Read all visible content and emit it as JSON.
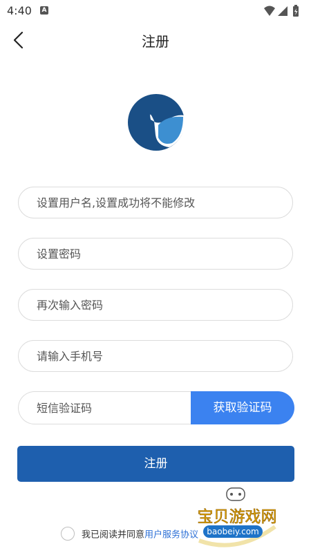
{
  "status_bar": {
    "time": "4:40",
    "notification_letter": "A"
  },
  "nav": {
    "title": "注册"
  },
  "form": {
    "username_placeholder": "设置用户名,设置成功将不能修改",
    "password_placeholder": "设置密码",
    "confirm_password_placeholder": "再次输入密码",
    "phone_placeholder": "请输入手机号",
    "sms_code_placeholder": "短信验证码",
    "get_code_label": "获取验证码",
    "submit_label": "注册"
  },
  "agreement": {
    "prefix": "我已阅读并同意",
    "link": "用户服务协议"
  },
  "watermark": {
    "title": "宝贝游戏网",
    "url": "baobeiy.com"
  },
  "colors": {
    "primary": "#1e5fae",
    "accent": "#3b82f0",
    "logo_dark": "#1a4f86",
    "logo_light": "#3d8fd1",
    "link": "#2b6fd6"
  },
  "icons": {
    "back": "chevron-left-icon",
    "wifi": "wifi-icon",
    "signal": "signal-icon",
    "battery": "battery-icon"
  }
}
